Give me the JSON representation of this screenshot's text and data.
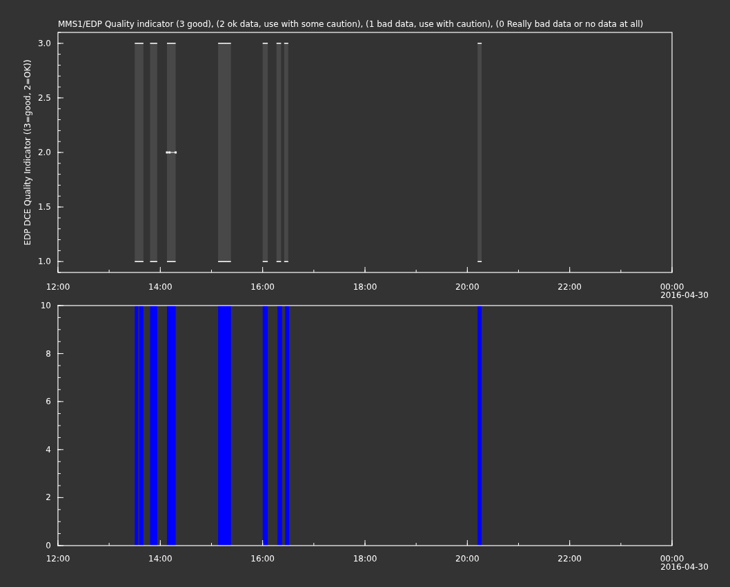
{
  "title": "MMS1/EDP  Quality indicator (3 good), (2 ok data, use with some caution), (1 bad data, use with caution), (0 Really bad data or no data at all)",
  "top_plot": {
    "chart_data": {
      "type": "line",
      "ylabel": "EDP DCE Quality Indicator ((3=good, 2=OK))",
      "xlim": [
        12,
        24
      ],
      "ylim": [
        0.9,
        3.1
      ],
      "x": [
        13.5,
        13.67,
        null,
        13.8,
        13.94,
        null,
        14.13,
        14.18,
        14.3,
        null,
        15.13,
        15.38,
        null,
        16.0,
        16.1,
        null,
        16.27,
        16.36,
        null,
        16.42,
        16.5,
        null,
        20.2,
        20.28
      ],
      "series": [
        {
          "color": "#ffffff",
          "values": [
            3,
            3,
            null,
            3,
            3,
            null,
            3,
            3,
            3,
            null,
            3,
            3,
            null,
            3,
            3,
            null,
            3,
            3,
            null,
            3,
            3,
            null,
            3,
            3
          ]
        },
        {
          "color": "#ffffff",
          "values": [
            1,
            1,
            null,
            1,
            1,
            null,
            1,
            1,
            1,
            null,
            1,
            1,
            null,
            1,
            1,
            null,
            1,
            1,
            null,
            1,
            1,
            null,
            1,
            1
          ]
        },
        {
          "color": "#ffffff",
          "marker": "square",
          "values": [
            null,
            null,
            null,
            null,
            null,
            null,
            2,
            2,
            2,
            null,
            null,
            null,
            null,
            null,
            null,
            null,
            null,
            null,
            null,
            null,
            null,
            null,
            null,
            null
          ]
        }
      ],
      "xticks": [
        {
          "value": 12,
          "label": "12:00"
        },
        {
          "value": 14,
          "label": "14:00"
        },
        {
          "value": 16,
          "label": "16:00"
        },
        {
          "value": 18,
          "label": "18:00"
        },
        {
          "value": 20,
          "label": "20:00"
        },
        {
          "value": 22,
          "label": "22:00"
        },
        {
          "value": 24,
          "label": "00:00"
        }
      ],
      "yticks": [
        {
          "value": 1,
          "label": "1.0"
        },
        {
          "value": 1.5,
          "label": "1.5"
        },
        {
          "value": 2,
          "label": "2.0"
        },
        {
          "value": 2.5,
          "label": "2.5"
        },
        {
          "value": 3,
          "label": "3.0"
        }
      ]
    },
    "date_label": "2016-04-30"
  },
  "bottom_plot": {
    "chart_data": {
      "type": "area",
      "xlim": [
        12,
        24
      ],
      "ylim": [
        0,
        10
      ],
      "x": [
        13.5,
        13.5,
        13.57,
        13.57,
        13.59,
        13.59,
        13.67,
        13.67,
        13.8,
        13.8,
        13.94,
        13.94,
        14.13,
        14.13,
        14.3,
        14.3,
        15.13,
        15.13,
        15.38,
        15.38,
        16.0,
        16.0,
        16.1,
        16.1,
        16.29,
        16.29,
        16.38,
        16.38,
        16.44,
        16.44,
        16.52,
        16.52,
        20.2,
        20.2,
        20.28,
        20.28
      ],
      "series": [
        {
          "color": "#0000ff",
          "values": [
            0,
            10,
            10,
            0,
            0,
            10,
            10,
            0,
            0,
            10,
            10,
            0,
            0,
            10,
            10,
            0,
            0,
            10,
            10,
            0,
            0,
            10,
            10,
            0,
            0,
            10,
            10,
            0,
            0,
            10,
            10,
            0,
            0,
            10,
            10,
            0
          ]
        }
      ],
      "xticks": [
        {
          "value": 12,
          "label": "12:00"
        },
        {
          "value": 14,
          "label": "14:00"
        },
        {
          "value": 16,
          "label": "16:00"
        },
        {
          "value": 18,
          "label": "18:00"
        },
        {
          "value": 20,
          "label": "20:00"
        },
        {
          "value": 22,
          "label": "22:00"
        },
        {
          "value": 24,
          "label": "00:00"
        }
      ],
      "yticks": [
        0,
        2,
        4,
        6,
        8,
        10
      ]
    },
    "date_label": "2016-04-30"
  }
}
